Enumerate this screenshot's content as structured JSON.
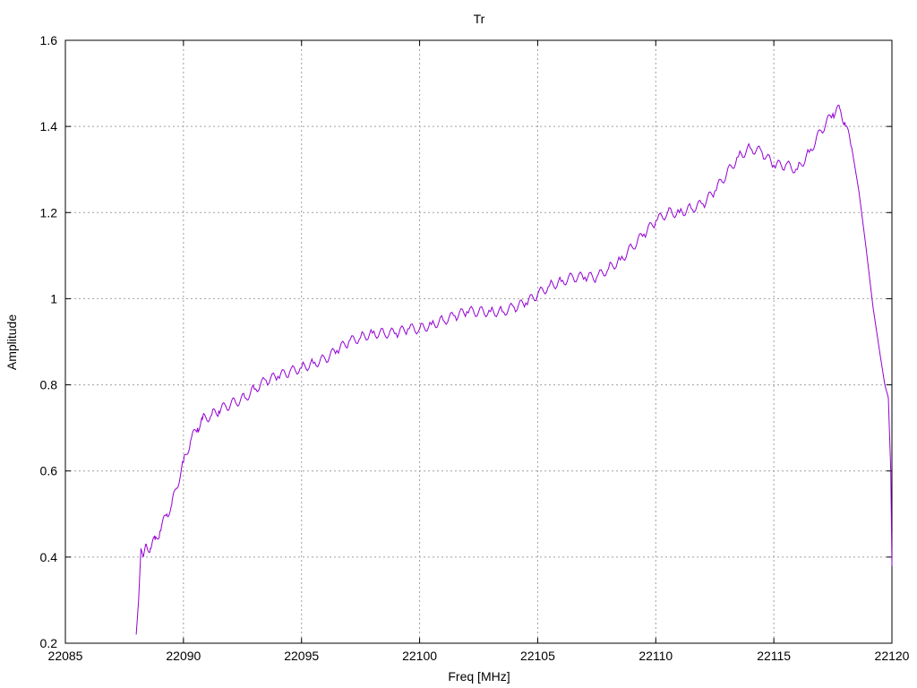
{
  "chart_data": {
    "type": "line",
    "title": "Tr",
    "xlabel": "Freq [MHz]",
    "ylabel": "Amplitude",
    "xlim": [
      22085,
      22120
    ],
    "ylim": [
      0.2,
      1.6
    ],
    "grid": true,
    "xticks": [
      22085,
      22090,
      22095,
      22100,
      22105,
      22110,
      22115,
      22120
    ],
    "yticks": [
      0.2,
      0.4,
      0.6,
      0.8,
      1.0,
      1.2,
      1.4,
      1.6
    ],
    "xtick_labels": [
      "22085",
      "22090",
      "22095",
      "22100",
      "22105",
      "22110",
      "22115",
      "22120"
    ],
    "ytick_labels": [
      "0.2",
      "0.4",
      "0.6",
      "0.8",
      "1",
      "1.2",
      "1.4",
      "1.6"
    ],
    "series": [
      {
        "color": "#9400d3",
        "x": [
          22088.0,
          22088.1,
          22088.2,
          22088.3,
          22088.4,
          22088.6,
          22088.8,
          22089.0,
          22089.3,
          22089.5,
          22089.7,
          22090.0,
          22090.3,
          22090.6,
          22090.8,
          22091.2,
          22091.5,
          22091.8,
          22092.2,
          22092.6,
          22093.0,
          22093.5,
          22094.0,
          22094.5,
          22095.0,
          22095.5,
          22096.0,
          22096.5,
          22097.0,
          22097.5,
          22098.0,
          22098.5,
          22099.0,
          22099.5,
          22100.0,
          22100.5,
          22101.0,
          22101.5,
          22102.0,
          22102.5,
          22103.0,
          22103.5,
          22104.0,
          22104.5,
          22105.0,
          22105.5,
          22106.0,
          22106.5,
          22107.0,
          22107.5,
          22108.0,
          22108.5,
          22109.0,
          22109.5,
          22110.0,
          22110.5,
          22111.0,
          22111.5,
          22112.0,
          22112.5,
          22113.0,
          22113.5,
          22114.0,
          22114.5,
          22115.0,
          22115.5,
          22116.0,
          22116.5,
          22117.0,
          22117.5,
          22117.8,
          22118.0,
          22118.3,
          22118.6,
          22118.9,
          22119.2,
          22119.5,
          22119.7,
          22119.85,
          22119.95,
          22120.0
        ],
        "y": [
          0.22,
          0.3,
          0.42,
          0.4,
          0.43,
          0.42,
          0.44,
          0.46,
          0.5,
          0.52,
          0.56,
          0.62,
          0.67,
          0.7,
          0.72,
          0.73,
          0.74,
          0.75,
          0.76,
          0.77,
          0.79,
          0.81,
          0.82,
          0.83,
          0.84,
          0.85,
          0.86,
          0.88,
          0.9,
          0.91,
          0.92,
          0.92,
          0.92,
          0.93,
          0.93,
          0.94,
          0.95,
          0.96,
          0.97,
          0.97,
          0.97,
          0.97,
          0.98,
          0.99,
          1.01,
          1.03,
          1.04,
          1.05,
          1.05,
          1.05,
          1.07,
          1.09,
          1.12,
          1.15,
          1.18,
          1.2,
          1.2,
          1.21,
          1.22,
          1.25,
          1.29,
          1.33,
          1.35,
          1.34,
          1.31,
          1.31,
          1.3,
          1.34,
          1.39,
          1.43,
          1.44,
          1.41,
          1.35,
          1.25,
          1.12,
          0.98,
          0.87,
          0.8,
          0.77,
          0.6,
          0.38
        ]
      }
    ]
  }
}
